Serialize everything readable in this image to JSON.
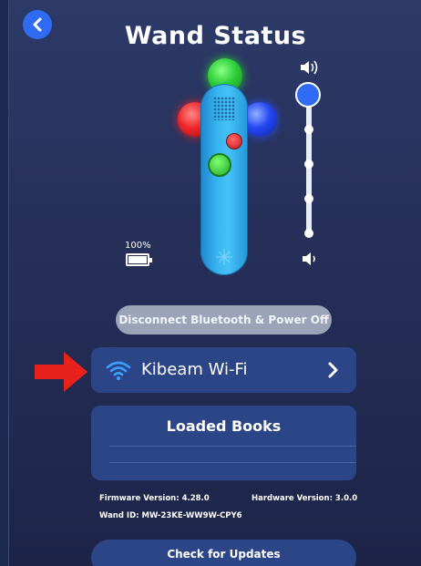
{
  "header": {
    "title": "Wand Status",
    "back_icon": "chevron-left-icon"
  },
  "battery": {
    "level_text": "100%",
    "level": 1.0
  },
  "volume": {
    "level": 1.0,
    "steps": 5,
    "high_icon": "volume-high-icon",
    "low_icon": "volume-low-icon"
  },
  "actions": {
    "disconnect_label": "Disconnect Bluetooth & Power Off"
  },
  "wifi": {
    "label": "Kibeam Wi-Fi",
    "icon": "wifi-icon"
  },
  "books": {
    "title": "Loaded Books"
  },
  "info": {
    "firmware": "Firmware Version: 4.28.0",
    "hardware": "Hardware Version: 3.0.0",
    "wand_id": "Wand ID: MW-23KE-WW9W-CPY6"
  },
  "updates": {
    "label": "Check for Updates"
  },
  "colors": {
    "accent": "#2f6bf3",
    "card": "#2c4586",
    "orb_green": "#2fcf3a",
    "orb_red": "#f0262a",
    "orb_blue": "#2648f2",
    "arrow": "#e8211d"
  }
}
